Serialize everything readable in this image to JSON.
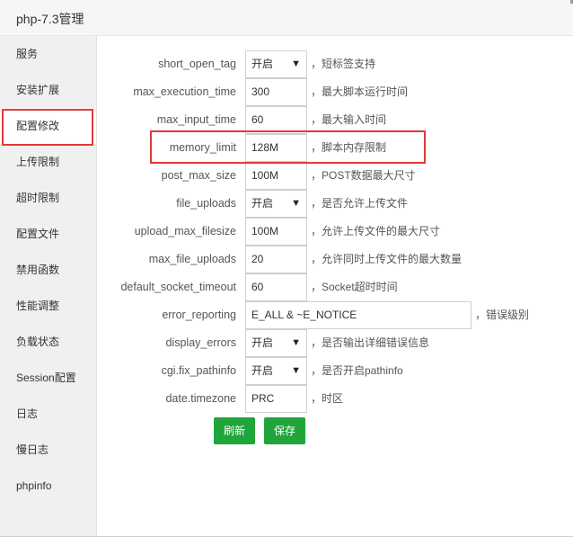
{
  "window": {
    "title": "php-7.3管理"
  },
  "sidebar": {
    "items": [
      {
        "label": "服务"
      },
      {
        "label": "安装扩展"
      },
      {
        "label": "配置修改"
      },
      {
        "label": "上传限制"
      },
      {
        "label": "超时限制"
      },
      {
        "label": "配置文件"
      },
      {
        "label": "禁用函数"
      },
      {
        "label": "性能调整"
      },
      {
        "label": "负载状态"
      },
      {
        "label": "Session配置"
      },
      {
        "label": "日志"
      },
      {
        "label": "慢日志"
      },
      {
        "label": "phpinfo"
      }
    ],
    "active": "配置修改"
  },
  "settings": [
    {
      "key": "short_open_tag",
      "type": "select",
      "value": "开启",
      "desc": "，短标签支持"
    },
    {
      "key": "max_execution_time",
      "type": "input",
      "value": "300",
      "desc": "，最大脚本运行时间"
    },
    {
      "key": "max_input_time",
      "type": "input",
      "value": "60",
      "desc": "，最大输入时间"
    },
    {
      "key": "memory_limit",
      "type": "input",
      "value": "128M",
      "desc": "，脚本内存限制"
    },
    {
      "key": "post_max_size",
      "type": "input",
      "value": "100M",
      "desc": "，POST数据最大尺寸"
    },
    {
      "key": "file_uploads",
      "type": "select",
      "value": "开启",
      "desc": "，是否允许上传文件"
    },
    {
      "key": "upload_max_filesize",
      "type": "input",
      "value": "100M",
      "desc": "，允许上传文件的最大尺寸"
    },
    {
      "key": "max_file_uploads",
      "type": "input",
      "value": "20",
      "desc": "，允许同时上传文件的最大数量"
    },
    {
      "key": "default_socket_timeout",
      "type": "input",
      "value": "60",
      "desc": "，Socket超时时间"
    },
    {
      "key": "error_reporting",
      "type": "input",
      "value": "E_ALL & ~E_NOTICE",
      "desc": "，错误级别"
    },
    {
      "key": "display_errors",
      "type": "select",
      "value": "开启",
      "desc": "，是否输出详细错误信息"
    },
    {
      "key": "cgi.fix_pathinfo",
      "type": "select",
      "value": "开启",
      "desc": "，是否开启pathinfo"
    },
    {
      "key": "date.timezone",
      "type": "input",
      "value": "PRC",
      "desc": "，时区"
    }
  ],
  "buttons": {
    "refresh": "刷新",
    "save": "保存"
  },
  "colors": {
    "accent": "#20a53a",
    "highlight": "#e53935"
  }
}
